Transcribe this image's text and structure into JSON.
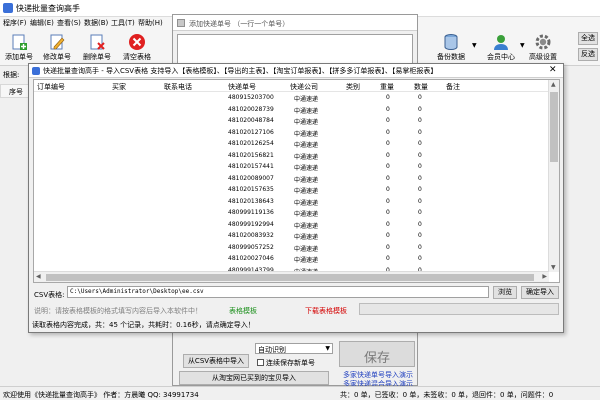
{
  "main_window": {
    "title": "快递批量查询高手",
    "menu": [
      "程序(F)",
      "编辑(E)",
      "查看(S)",
      "数据(B)",
      "工具(T)",
      "帮助(H)"
    ],
    "toolbar": {
      "add": "添加单号",
      "edit": "修改单号",
      "delete": "删除单号",
      "clear": "清空表格",
      "backup": "备份数据",
      "member": "会员中心",
      "settings": "高级设置"
    },
    "right_buttons": [
      "全选",
      "反选"
    ],
    "filter_label": "根据:",
    "grid_first_column": "序号",
    "status_left": "欢迎使用《快递批量查询高手》 作者：方晨曦  QQ: 34991734",
    "status_right": "共：0 单，已签收：0 单，未签收：0 单，退回件：0 单，问题件：0"
  },
  "add_dialog": {
    "title": "添加快递单号 （一行一个单号）",
    "recognize_select": "自动识别",
    "save_label": "保存",
    "from_csv": "从CSV表格中导入",
    "save_new_checkbox": "连续保存新单号",
    "from_taobao": "从淘宝网已买到的宝贝导入",
    "link_multi_import": "多家快递单号导入演示",
    "link_mixed_import": "多家快递混合导入演示"
  },
  "import_dialog": {
    "title": "快递批量查询高手 - 导入CSV表格 支持导入【表格模板】、【导出的主表】、【淘宝订单报表】、【拼多多订单报表】、【易掌柜报表】",
    "columns": [
      "订单编号",
      "买家",
      "联系电话",
      "快递单号",
      "快递公司",
      "类别",
      "重量",
      "数量",
      "备注"
    ],
    "rows": [
      {
        "tracking": "480915203700",
        "courier": "中通速递",
        "weight": "0",
        "qty": "0"
      },
      {
        "tracking": "481020028739",
        "courier": "中通速递",
        "weight": "0",
        "qty": "0"
      },
      {
        "tracking": "481020048784",
        "courier": "中通速递",
        "weight": "0",
        "qty": "0"
      },
      {
        "tracking": "481020127106",
        "courier": "中通速递",
        "weight": "0",
        "qty": "0"
      },
      {
        "tracking": "481020126254",
        "courier": "中通速递",
        "weight": "0",
        "qty": "0"
      },
      {
        "tracking": "481020156821",
        "courier": "中通速递",
        "weight": "0",
        "qty": "0"
      },
      {
        "tracking": "481020157441",
        "courier": "中通速递",
        "weight": "0",
        "qty": "0"
      },
      {
        "tracking": "481020089007",
        "courier": "中通速递",
        "weight": "0",
        "qty": "0"
      },
      {
        "tracking": "481020157635",
        "courier": "中通速递",
        "weight": "0",
        "qty": "0"
      },
      {
        "tracking": "481020138643",
        "courier": "中通速递",
        "weight": "0",
        "qty": "0"
      },
      {
        "tracking": "480999119136",
        "courier": "中通速递",
        "weight": "0",
        "qty": "0"
      },
      {
        "tracking": "480999192994",
        "courier": "中通速递",
        "weight": "0",
        "qty": "0"
      },
      {
        "tracking": "481020083932",
        "courier": "中通速递",
        "weight": "0",
        "qty": "0"
      },
      {
        "tracking": "480999057252",
        "courier": "中通速递",
        "weight": "0",
        "qty": "0"
      },
      {
        "tracking": "481020027046",
        "courier": "中通速递",
        "weight": "0",
        "qty": "0"
      },
      {
        "tracking": "480999143799",
        "courier": "中通速递",
        "weight": "0",
        "qty": "0"
      }
    ],
    "csv_label": "CSV表格:",
    "csv_path": "C:\\Users\\Administrator\\Desktop\\ee.csv",
    "browse": "浏览",
    "confirm_import": "确定导入",
    "hint": "说明：请按表格模板的格式填写内容后导入本软件中！",
    "template_link": "表格模板",
    "download_template_link": "下载表格模板",
    "read_status": "读取表格内容完成，共：45 个记录，共耗时：0.16秒，请点确定导入！"
  },
  "colors": {
    "link_green": "#1a8f1a",
    "link_red": "#d40000",
    "link_blue": "#1f3fbf",
    "delete_red": "#e02020",
    "window_bg": "#f0f0f0"
  }
}
